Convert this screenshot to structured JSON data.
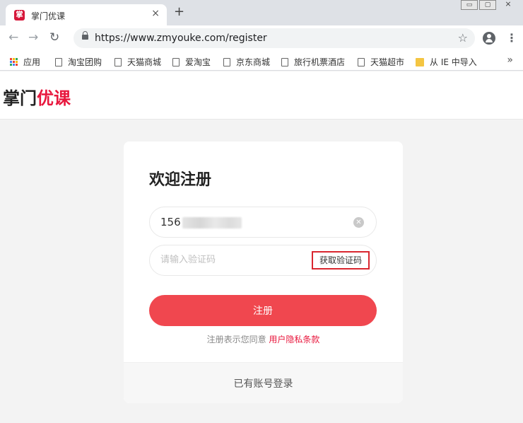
{
  "browser": {
    "tab": {
      "title": "掌门优课",
      "favicon_glyph": "掌",
      "close": "×"
    },
    "new_tab": "+",
    "window_controls": {
      "minimize": "▭",
      "restore": "▢",
      "close": "⨯"
    },
    "nav": {
      "back": "←",
      "forward": "→",
      "reload": "↻"
    },
    "address": "https://www.zmyouke.com/register",
    "star": "☆",
    "menu": "⋮",
    "bookmarks": [
      {
        "label": "应用",
        "icon": "apps-icon"
      },
      {
        "label": "淘宝团购",
        "icon": "page-icon"
      },
      {
        "label": "天猫商城",
        "icon": "page-icon"
      },
      {
        "label": "爱淘宝",
        "icon": "page-icon"
      },
      {
        "label": "京东商城",
        "icon": "page-icon"
      },
      {
        "label": "旅行机票酒店",
        "icon": "page-icon"
      },
      {
        "label": "天猫超市",
        "icon": "page-icon"
      },
      {
        "label": "从 IE 中导入",
        "icon": "folder-icon"
      }
    ],
    "bookmarks_more": "»"
  },
  "site": {
    "logo_part1": "掌门",
    "logo_part2": "优课",
    "brand_color": "#e8173d"
  },
  "register": {
    "title": "欢迎注册",
    "phone_value": "156",
    "code_placeholder": "请输入验证码",
    "get_code_label": "获取验证码",
    "submit_label": "注册",
    "agreement_prefix": "注册表示您同意",
    "agreement_link": "用户隐私条款",
    "login_label": "已有账号登录",
    "button_color": "#f0474f"
  }
}
